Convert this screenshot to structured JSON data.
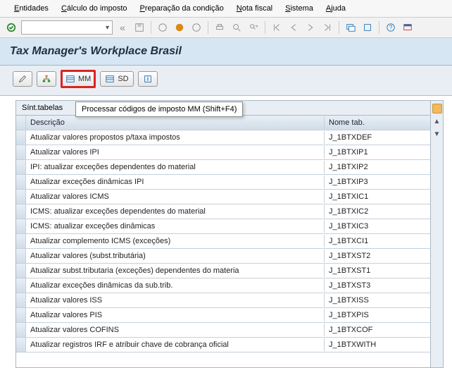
{
  "menu": {
    "entidades": "Entidades",
    "calculo": "Cálculo do imposto",
    "preparacao": "Preparação da condição",
    "nota": "Nota fiscal",
    "sistema": "Sistema",
    "ajuda": "Ajuda"
  },
  "title": "Tax Manager's Workplace Brasil",
  "sub": {
    "mm": "MM",
    "sd": "SD"
  },
  "tooltip": "Processar códigos de imposto MM   (Shift+F4)",
  "table": {
    "tab": "Sínt.tabelas",
    "col_desc": "Descrição",
    "col_name": "Nome tab.",
    "rows": [
      {
        "desc": "Atualizar valores propostos p/taxa impostos",
        "name": "J_1BTXDEF"
      },
      {
        "desc": "Atualizar valores IPI",
        "name": "J_1BTXIP1"
      },
      {
        "desc": "IPI: atualizar exceções dependentes do material",
        "name": "J_1BTXIP2"
      },
      {
        "desc": "Atualizar exceções dinâmicas IPI",
        "name": "J_1BTXIP3"
      },
      {
        "desc": "Atualizar valores ICMS",
        "name": "J_1BTXIC1"
      },
      {
        "desc": "ICMS: atualizar exceções dependentes do material",
        "name": "J_1BTXIC2"
      },
      {
        "desc": "ICMS: atualizar exceções dinâmicas",
        "name": "J_1BTXIC3"
      },
      {
        "desc": "Atualizar complemento ICMS (exceções)",
        "name": "J_1BTXCI1"
      },
      {
        "desc": "Atualizar valores (subst.tributária)",
        "name": "J_1BTXST2"
      },
      {
        "desc": "Atualizar subst.tributaria (exceções) dependentes do materia",
        "name": "J_1BTXST1"
      },
      {
        "desc": "Atualizar exceções dinâmicas da sub.trib.",
        "name": "J_1BTXST3"
      },
      {
        "desc": "Atualizar valores ISS",
        "name": "J_1BTXISS"
      },
      {
        "desc": "Atualizar valores PIS",
        "name": "J_1BTXPIS"
      },
      {
        "desc": "Atualizar valores COFINS",
        "name": "J_1BTXCOF"
      },
      {
        "desc": "Atualizar registros IRF e atribuir chave de cobrança oficial",
        "name": "J_1BTXWITH"
      }
    ]
  }
}
